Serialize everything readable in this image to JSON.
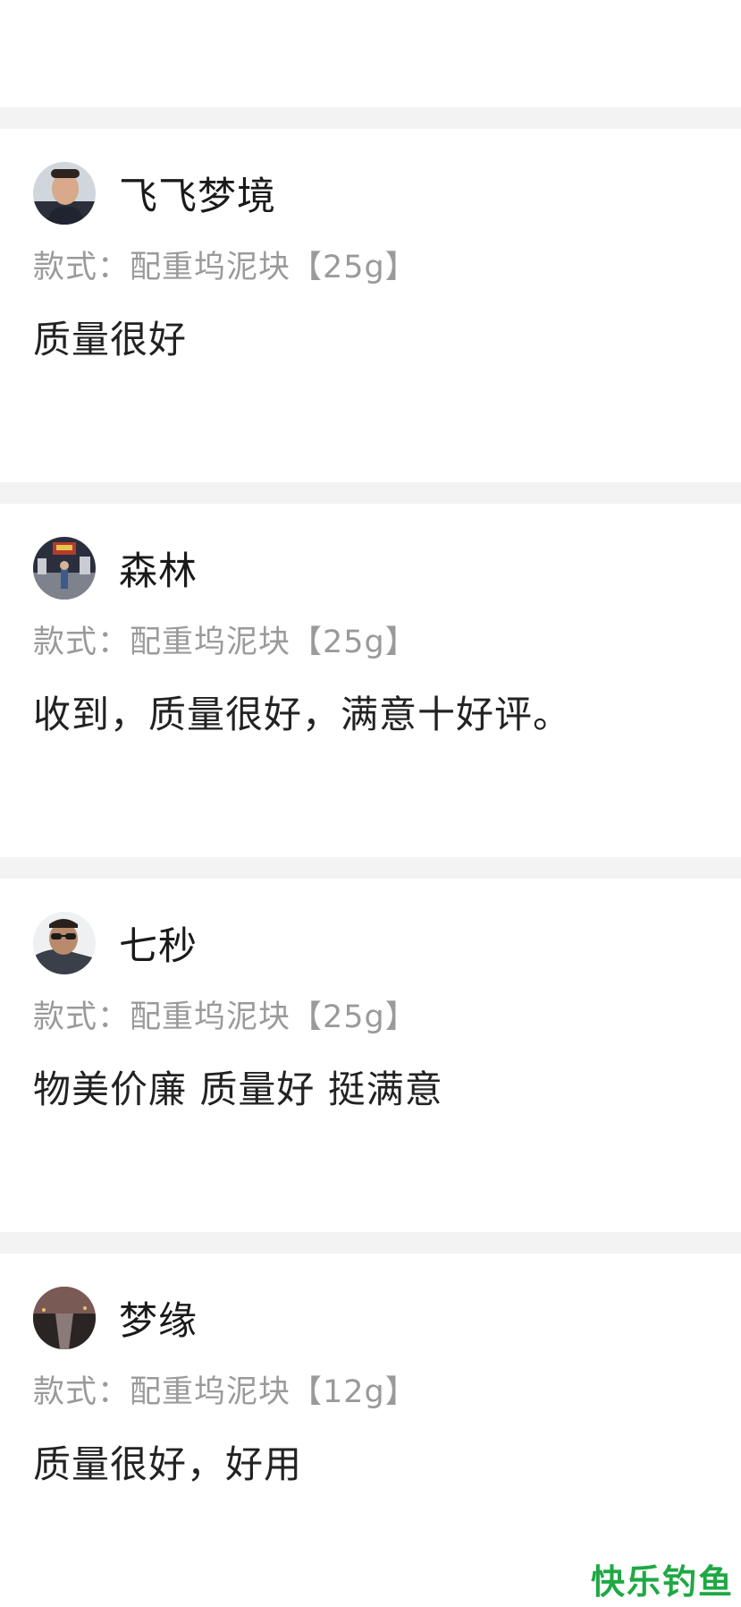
{
  "reviews": [
    {
      "username": "飞飞梦境",
      "style": "款式：配重坞泥块【25g】",
      "comment": "质量很好",
      "avatar_icon": "user-photo-portrait"
    },
    {
      "username": "森林",
      "style": "款式：配重坞泥块【25g】",
      "comment": "收到，质量很好，满意十好评。",
      "avatar_icon": "user-photo-street-night"
    },
    {
      "username": "七秒",
      "style": "款式：配重坞泥块【25g】",
      "comment": "物美价廉 质量好 挺满意",
      "avatar_icon": "user-photo-sunglasses"
    },
    {
      "username": "梦缘",
      "style": "款式：配重坞泥块【12g】",
      "comment": "质量很好，好用",
      "avatar_icon": "user-photo-river-dusk"
    }
  ],
  "watermark": "快乐钓鱼",
  "colors": {
    "divider": "#f3f3f3",
    "style_text": "#9a9a9a",
    "comment_text": "#222222",
    "watermark": "#1fa843"
  }
}
